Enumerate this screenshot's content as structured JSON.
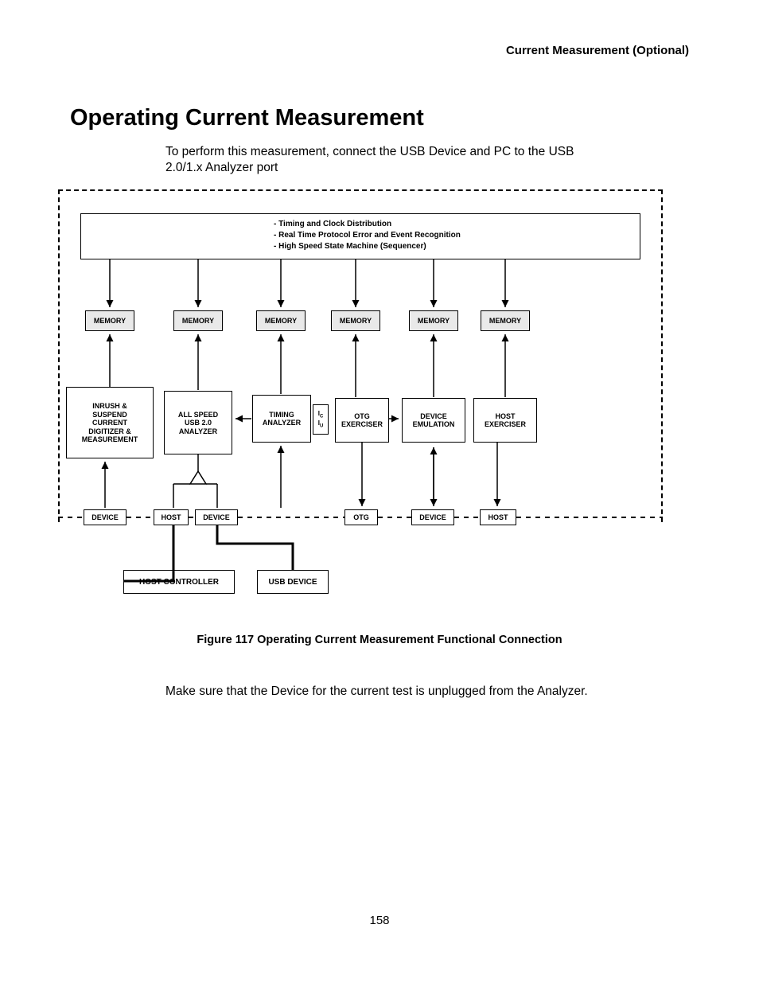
{
  "header": {
    "running": "Current Measurement (Optional)"
  },
  "title": "Operating Current Measurement",
  "intro": "To perform this measurement, connect the USB Device and PC to the USB 2.0/1.x Analyzer port",
  "topbar": {
    "l1": "- Timing and Clock Distribution",
    "l2": "- Real Time Protocol Error and Event Recognition",
    "l3": "- High Speed State Machine (Sequencer)"
  },
  "mem": [
    "MEMORY",
    "MEMORY",
    "MEMORY",
    "MEMORY",
    "MEMORY",
    "MEMORY"
  ],
  "mid": {
    "inrush_l1": "INRUSH &",
    "inrush_l2": "SUSPEND",
    "inrush_l3": "CURRENT",
    "inrush_l4": "DIGITIZER &",
    "inrush_l5": "MEASUREMENT",
    "analyzer_l1": "ALL SPEED",
    "analyzer_l2": "USB 2.0",
    "analyzer_l3": "ANALYZER",
    "timing_l1": "TIMING",
    "timing_l2": "ANALYZER",
    "otg_l1": "OTG",
    "otg_l2": "EXERCISER",
    "devemu_l1": "DEVICE",
    "devemu_l2": "EMULATION",
    "hostex_l1": "HOST",
    "hostex_l2": "EXERCISER"
  },
  "ic_label": "I",
  "ic_sub": "C",
  "iu_label": "I",
  "iu_sub": "U",
  "ports": {
    "device1": "DEVICE",
    "host1": "HOST",
    "device2": "DEVICE",
    "otg": "OTG",
    "device3": "DEVICE",
    "host2": "HOST"
  },
  "ext": {
    "hostctrl": "HOST CONTROLLER",
    "usbdev": "USB DEVICE"
  },
  "caption": "Figure  117  Operating Current Measurement Functional Connection",
  "note": "Make sure that the Device for the current test is unplugged from the Analyzer.",
  "page_number": "158"
}
